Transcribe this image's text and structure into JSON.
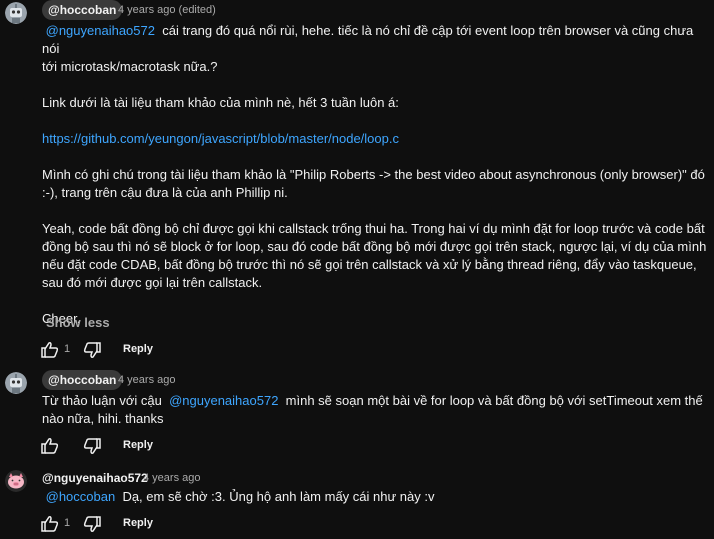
{
  "colors": {
    "background": "#0f0f0f",
    "text": "#f1f1f1",
    "secondary": "#aaaaaa",
    "link": "#3ea6ff",
    "chip": "#3a3a3a"
  },
  "comments": [
    {
      "author": "@hoccoban",
      "time": "4 years ago (edited)",
      "avatar_icon": "robot-avatar-icon",
      "mention": "@nguyenaihao572",
      "line1_rest": "cái trang đó quá nổi rùi, hehe. tiếc là nó chỉ đề cập tới event loop trên browser và cũng chưa nói",
      "line2": "tới microtask/macrotask nữa.?",
      "para2": "Link dưới là tài liệu tham khảo của mình nè, hết 3 tuần luôn á:",
      "link": "https://github.com/yeungon/javascript/blob/master/node/loop.c",
      "para4_line1": "Mình có ghi chú trong tài liệu tham khảo là \"Philip Roberts -> the best video about asynchronous (only browser)\" đó",
      "para4_line2": ":-), trang trên cậu đưa là của anh Phillip ni.",
      "para5_line1": "Yeah, code bất đồng bộ chỉ được gọi khi callstack trống thui ha. Trong hai ví dụ mình đặt for loop trước và code bất",
      "para5_line2": "đồng bộ sau thì nó sẽ block ở for loop, sau đó code bất đồng bộ mới được gọi trên stack, ngược lại, ví dụ của mình",
      "para5_line3": "nếu đặt code CDAB, bất đồng bộ trước thì nó sẽ gọi trên callstack và xử lý bằng thread riêng, đẩy vào taskqueue,",
      "para5_line4": "sau đó mới được gọi lại trên callstack.",
      "para6": "Cheer.",
      "show_less": "Show less",
      "likes": "1",
      "reply_label": "Reply"
    },
    {
      "author": "@hoccoban",
      "time": "4 years ago",
      "avatar_icon": "robot-avatar-icon",
      "line1_pre": "Từ thảo luận với cậu",
      "mention": "@nguyenaihao572",
      "line1_post": "mình sẽ soạn một bài về for loop và bất đồng bộ với setTimeout xem thế",
      "line2": "nào nữa, hihi. thanks",
      "likes": "",
      "reply_label": "Reply"
    },
    {
      "author": "@nguyenaihao572",
      "time": "4 years ago",
      "avatar_icon": "pig-avatar-icon",
      "mention": "@hoccoban",
      "line1_rest": "Dạ, em sẽ chờ :3. Ủng hộ anh làm mấy cái như này :v",
      "likes": "1",
      "reply_label": "Reply"
    }
  ]
}
